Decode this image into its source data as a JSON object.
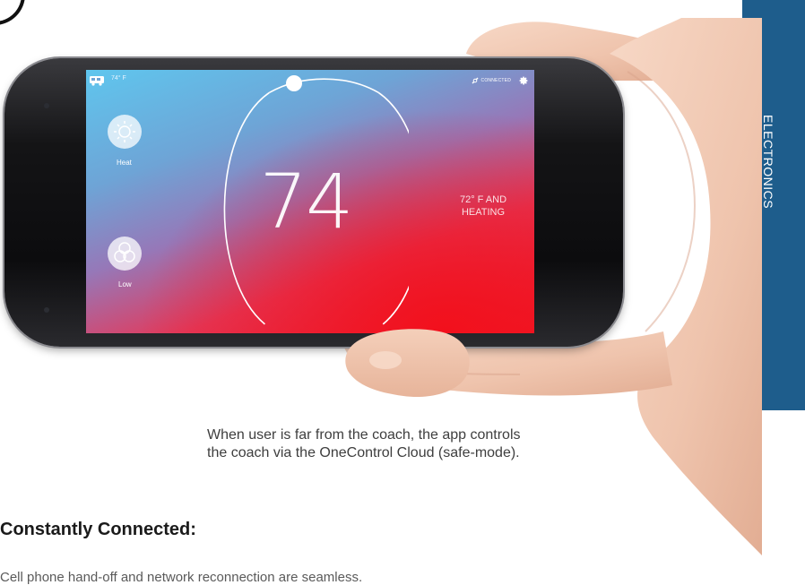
{
  "side_tab": {
    "label": "ELECTRONICS",
    "color": "#1e5d8c"
  },
  "app": {
    "status": {
      "temperature": "74° F",
      "connection": "CONNECTED"
    },
    "modes": [
      {
        "icon": "sun-icon",
        "label": "Heat"
      },
      {
        "icon": "fan-icon",
        "label": "Low"
      }
    ],
    "setpoint": "74",
    "status_line1": "72° F AND",
    "status_line2": "HEATING"
  },
  "body": {
    "paragraph_line1": "When user is far from the coach, the app controls",
    "paragraph_line2": "the coach via the OneControl Cloud (safe-mode).",
    "heading": "Constantly Connected:",
    "cut_line": "Cell phone hand-off and network reconnection are seamless."
  },
  "colors": {
    "screen_top": "#5fc6ee",
    "screen_bottom": "#ef1a2a"
  }
}
